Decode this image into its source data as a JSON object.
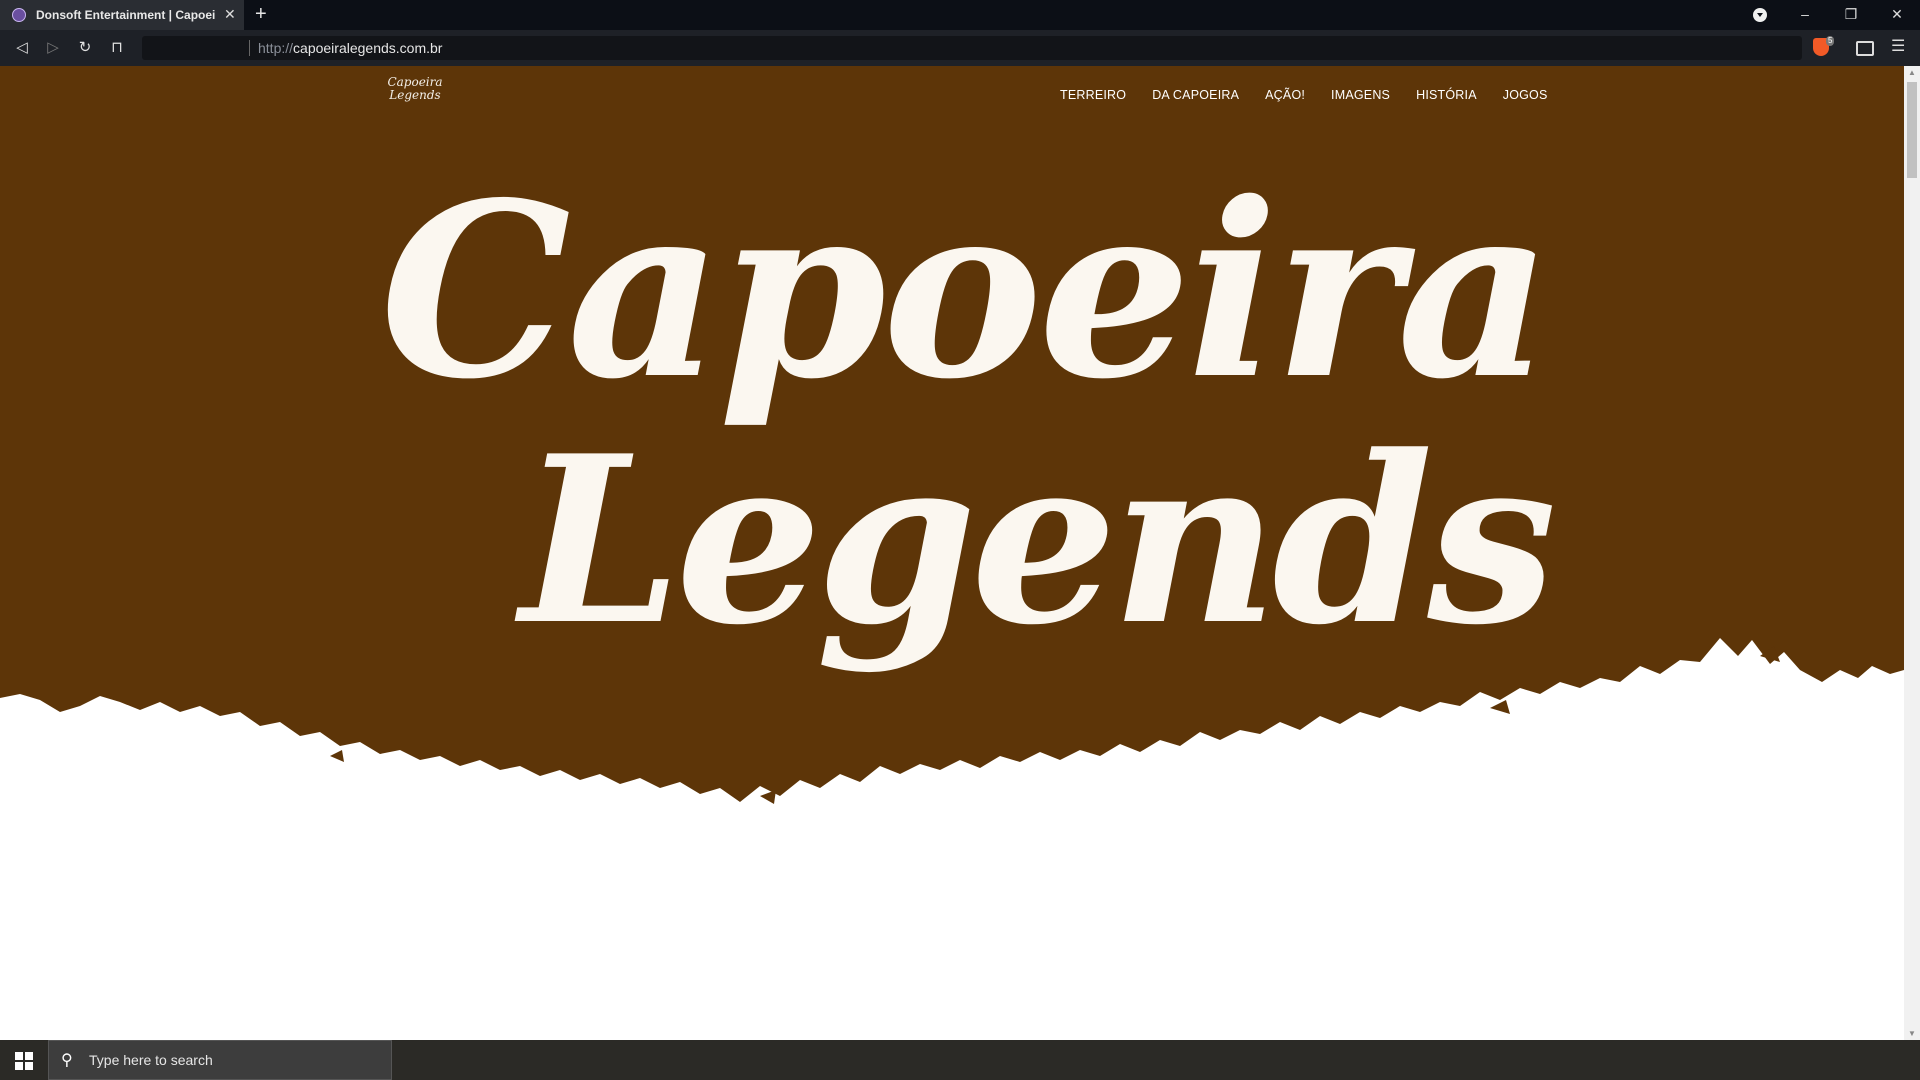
{
  "browser": {
    "tab_title": "Donsoft Entertainment | Capoeira Legends",
    "new_tab": "+",
    "tab_close": "✕",
    "url_protocol": "http://",
    "url_host": "capoeiralegends.com.br",
    "shield_count": "5",
    "window_controls": {
      "minimize": "–",
      "restore": "❐",
      "close": "✕"
    }
  },
  "site": {
    "logo_text": "Capoeira Legends",
    "nav": [
      "TERREIRO",
      "DA CAPOEIRA",
      "AÇÃO!",
      "IMAGENS",
      "HISTÓRIA",
      "JOGOS"
    ],
    "hero_line1": "Capoeira",
    "hero_line2": "Legends"
  },
  "taskbar": {
    "search_placeholder": "Type here to search"
  },
  "colors": {
    "hero_brown": "#5d3508",
    "hero_text": "#fbf7f0"
  }
}
